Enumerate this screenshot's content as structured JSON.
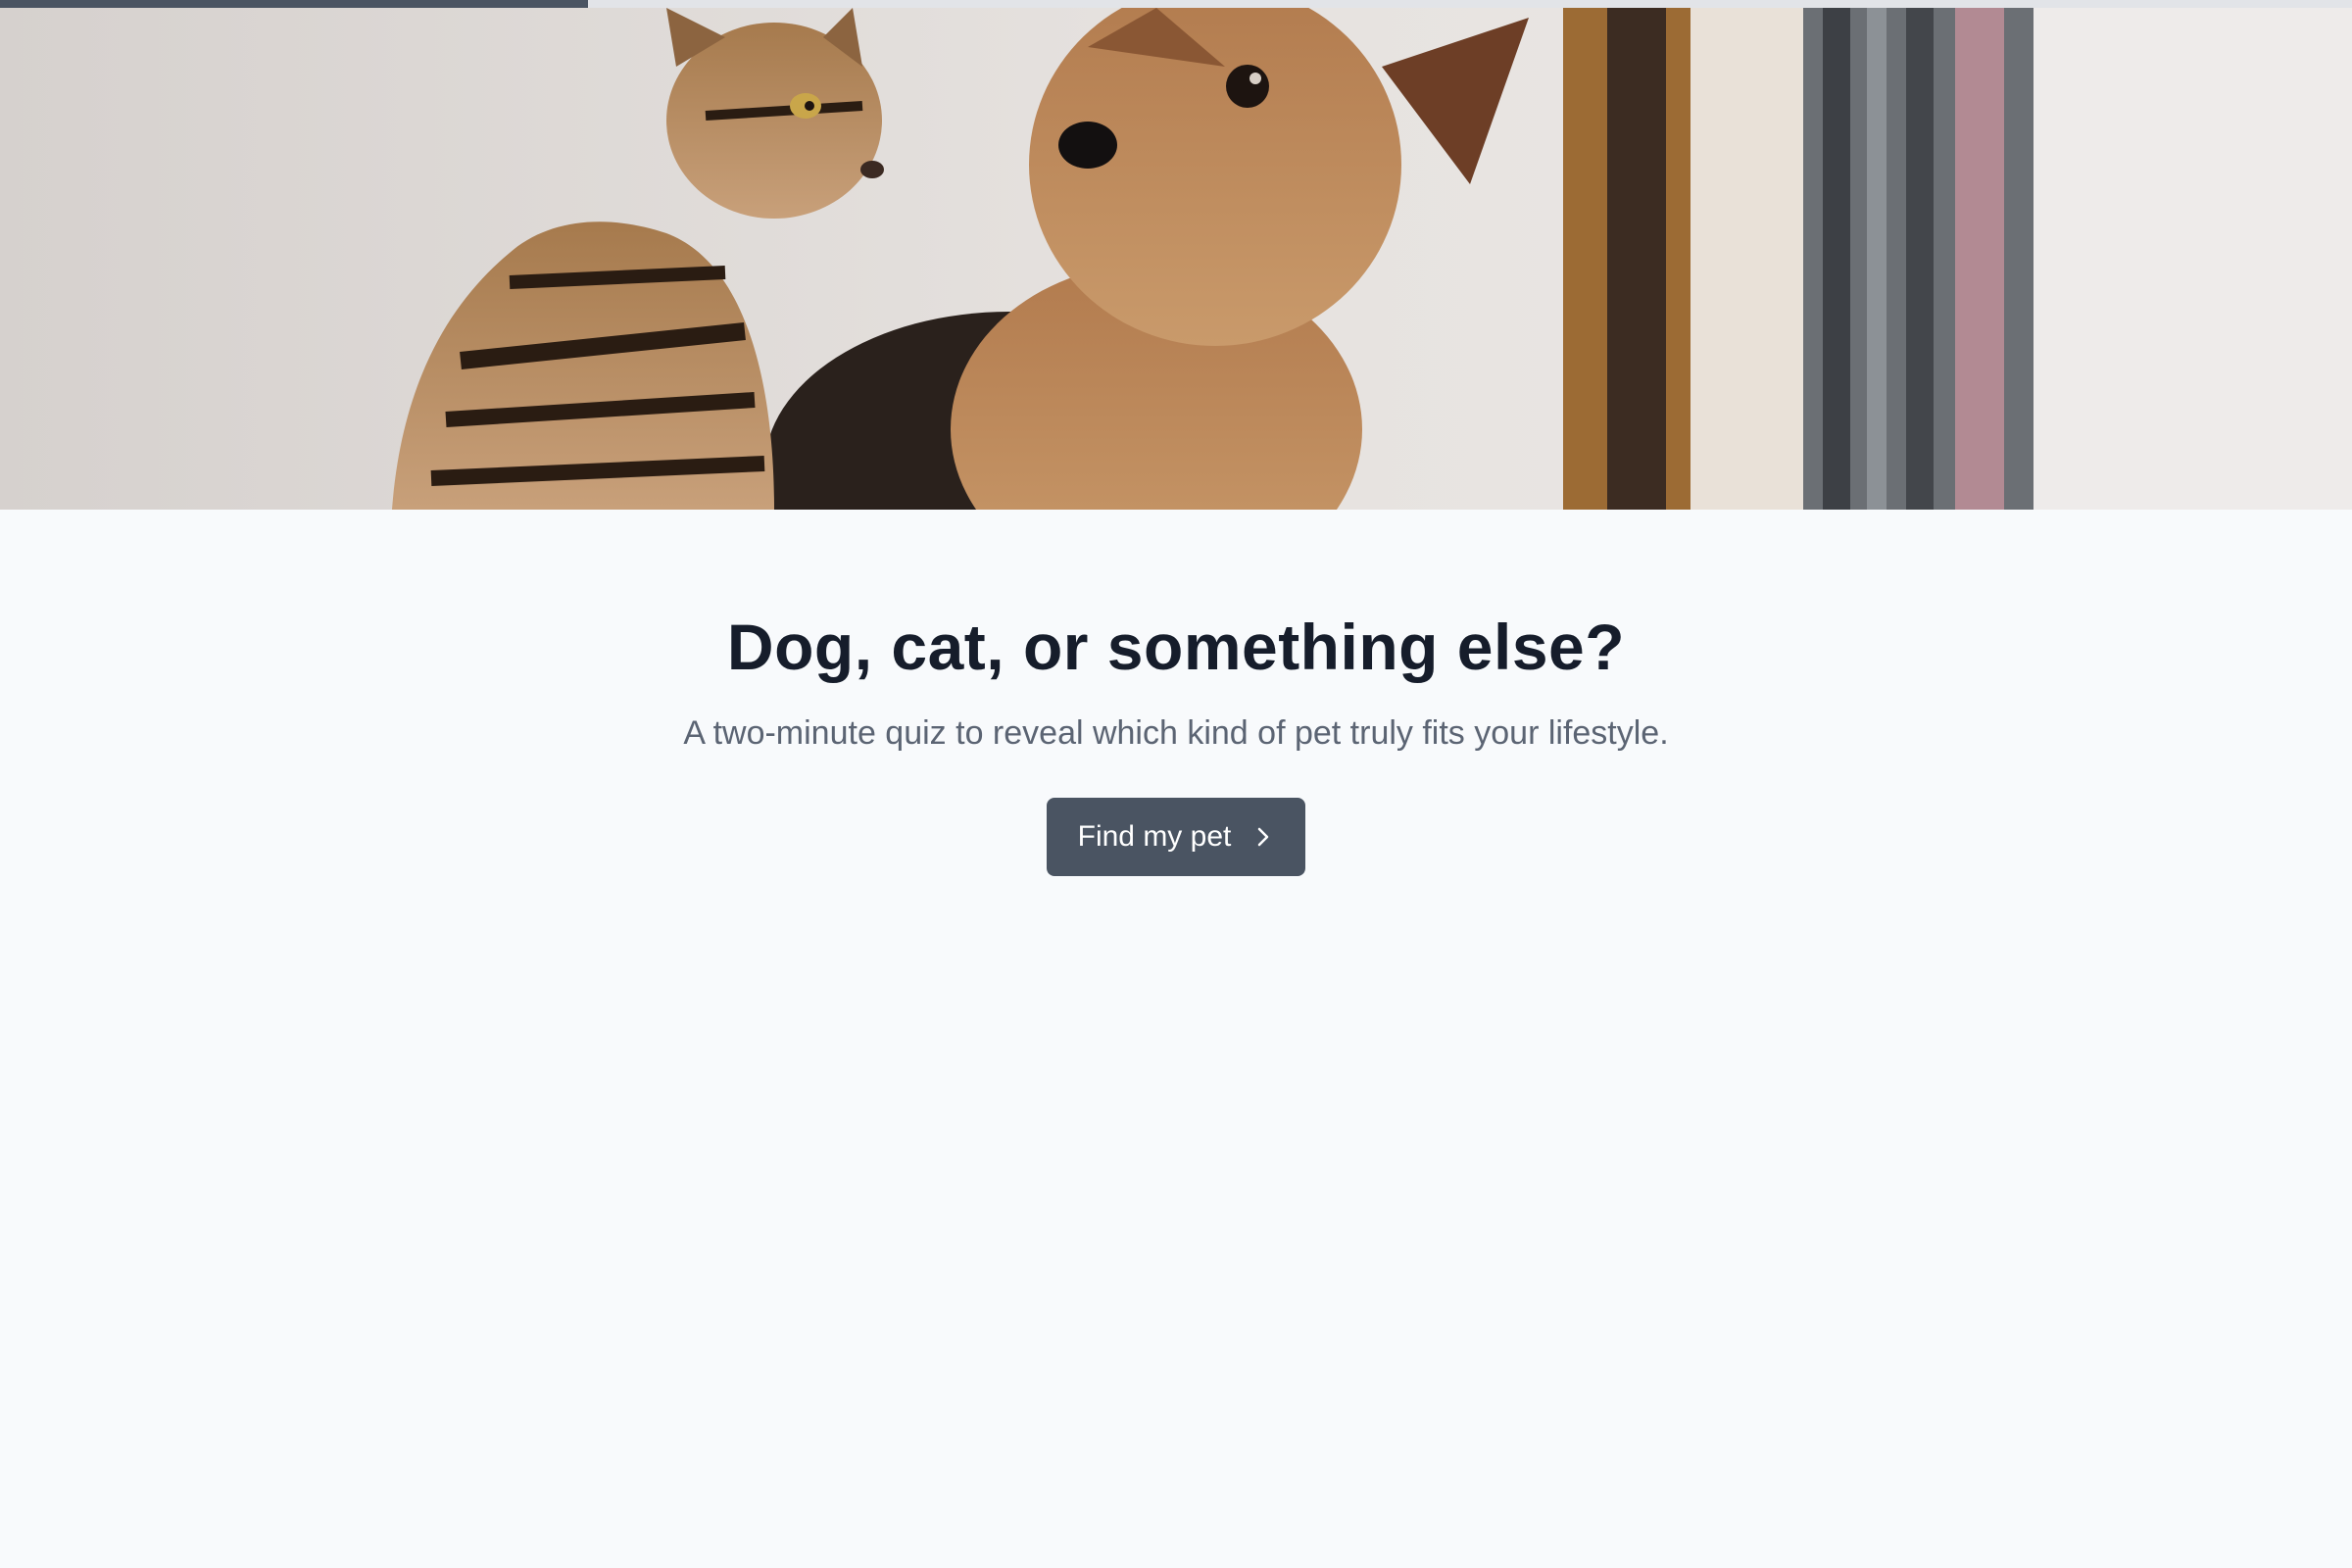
{
  "progress": {
    "fraction": 0.25,
    "color": "#4a5462",
    "track_color": "#e2e4e8"
  },
  "hero": {
    "image": "cat-and-dog-photo"
  },
  "main": {
    "title": "Dog, cat, or something else?",
    "subtitle": "A two-minute quiz to reveal which kind of pet truly fits your lifestyle.",
    "cta_label": "Find my pet",
    "cta_icon": "chevron-right-icon"
  },
  "colors": {
    "background": "#f8fafc",
    "title": "#161d2b",
    "subtitle": "#5b6473",
    "button": "#4a5462",
    "button_text": "#ffffff"
  }
}
